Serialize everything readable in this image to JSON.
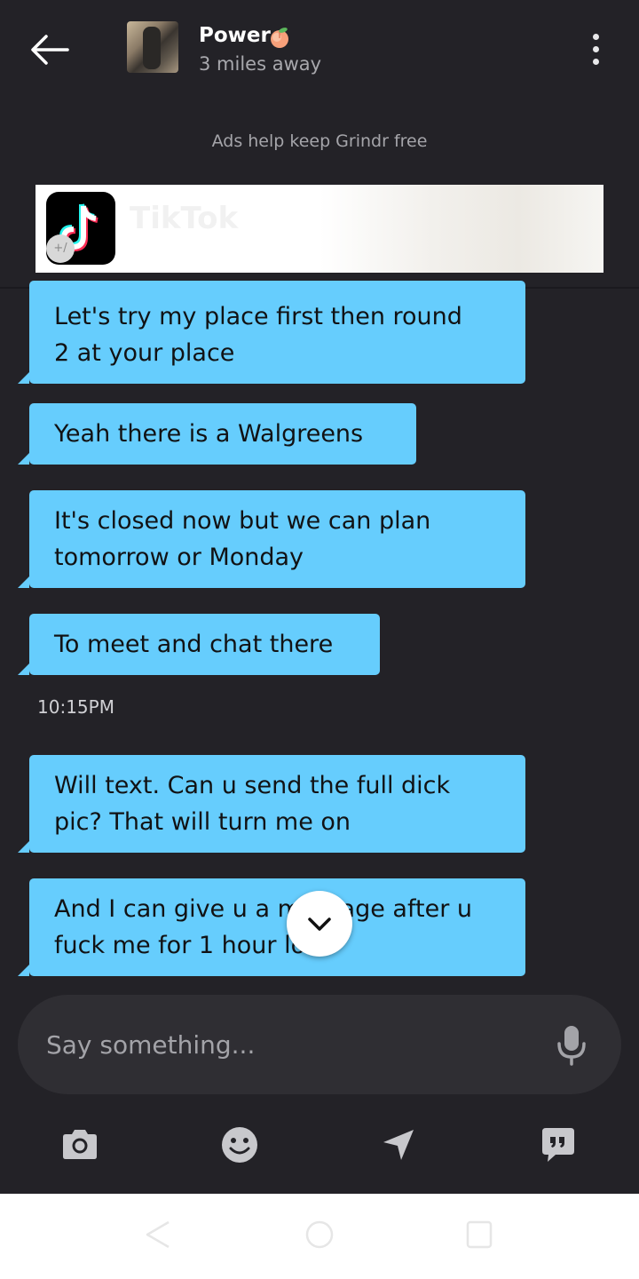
{
  "header": {
    "profile_name": "Power",
    "distance": "3 miles away",
    "icons": {
      "back": "back-arrow-icon",
      "peach": "peach-emoji-icon",
      "more": "more-vertical-icon"
    }
  },
  "ad": {
    "caption": "Ads help keep Grindr free",
    "brand": "TikTok",
    "badge": "+/"
  },
  "messages": [
    {
      "text_lines": [
        "Let's try my place first then round",
        "2 at your place"
      ]
    },
    {
      "text_lines": [
        "Yeah there is a Walgreens"
      ]
    },
    {
      "text_lines": [
        "It's closed now but we can plan",
        "tomorrow or Monday"
      ]
    },
    {
      "text_lines": [
        "To meet and chat there"
      ]
    },
    {
      "text_lines": [
        "Will text. Can u send the full dick",
        "pic? That will turn me on"
      ]
    },
    {
      "text_lines": [
        "And I can give u a massage after u",
        "fuck me for 1 hour lol"
      ]
    }
  ],
  "timestamp": "10:15PM",
  "composer": {
    "placeholder": "Say something..."
  },
  "toolbar": [
    "camera-icon",
    "emoji-icon",
    "send-location-icon",
    "saved-phrases-icon"
  ],
  "colors": {
    "background": "#232227",
    "bubble": "#66cdfd",
    "bubble_text": "#111214",
    "input": "#2f2e33"
  }
}
